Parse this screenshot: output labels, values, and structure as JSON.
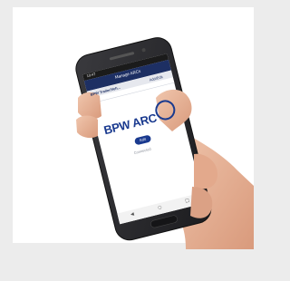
{
  "phone_ui": {
    "status_time": "10:47",
    "app_title": "Manage ARCs",
    "device_title": "BPW ARC",
    "menu_title": "BPW Trailer/Veh...",
    "action_label": "Add/Edit",
    "logo_text": "BPW ARC",
    "button_label": "Edit",
    "caption": "Connected"
  },
  "colors": {
    "app_bar": "#1d2f63",
    "logo_blue": "#1a3a8f",
    "phone_body": "#2a2a2d",
    "skin": "#e9b99f"
  }
}
